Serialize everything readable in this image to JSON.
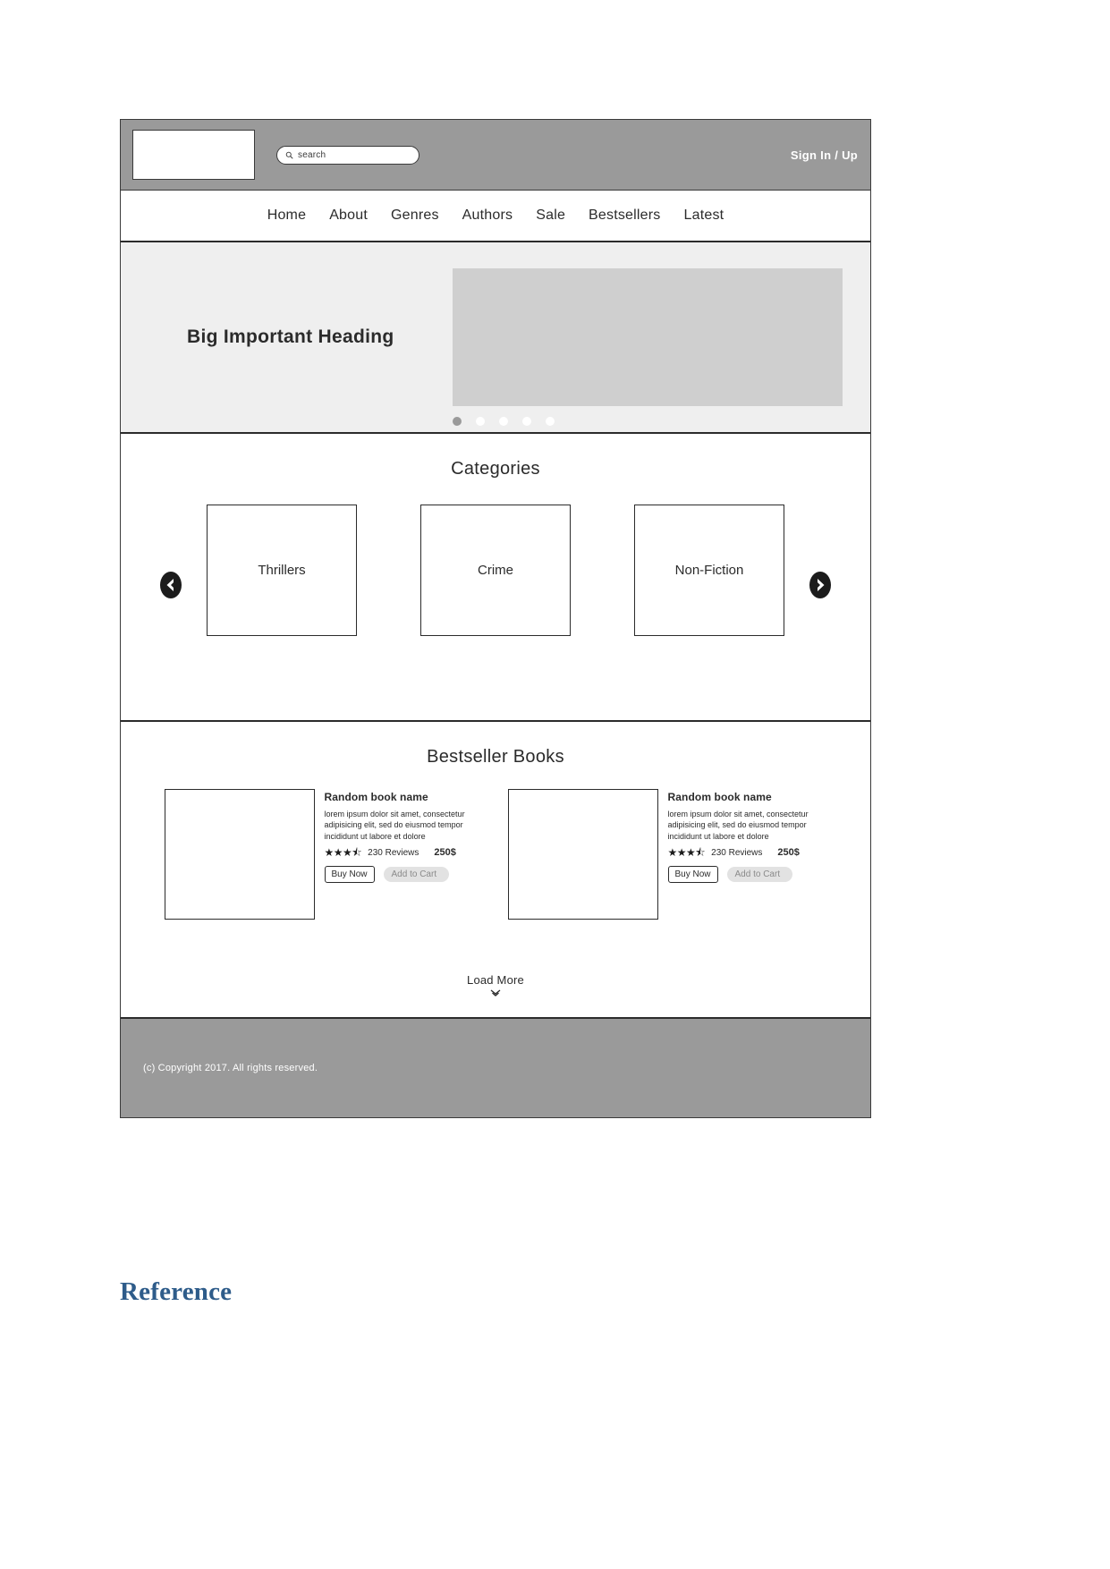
{
  "colors": {
    "bar_gray": "#9A9A9A",
    "hero_bg": "#EFEFEF",
    "placeholder_gray": "#CFCFCF",
    "outline": "#2B2B2B",
    "cart_btn_bg": "#E2E2E2",
    "reference_blue": "#2E5C8A"
  },
  "header": {
    "logo_alt": "logo-placeholder",
    "search": {
      "placeholder": "search",
      "value": "",
      "icon": "search-icon"
    },
    "signin_label": "Sign In / Up"
  },
  "nav": {
    "items": [
      {
        "label": "Home"
      },
      {
        "label": "About"
      },
      {
        "label": "Genres"
      },
      {
        "label": "Authors"
      },
      {
        "label": "Sale"
      },
      {
        "label": "Bestsellers"
      },
      {
        "label": "Latest"
      }
    ]
  },
  "hero": {
    "heading": "Big Important Heading",
    "image_alt": "hero-image-placeholder",
    "dots": [
      {
        "active": true
      },
      {
        "active": false
      },
      {
        "active": false
      },
      {
        "active": false
      },
      {
        "active": false
      }
    ]
  },
  "categories": {
    "title": "Categories",
    "prev_icon": "arrow-left-circle-icon",
    "next_icon": "arrow-right-circle-icon",
    "items": [
      {
        "label": "Thrillers"
      },
      {
        "label": "Crime"
      },
      {
        "label": "Non-Fiction"
      }
    ]
  },
  "bestsellers": {
    "title": "Bestseller Books",
    "books": [
      {
        "cover_alt": "book-cover-placeholder",
        "title": "Random book name",
        "description": "lorem ipsum dolor sit amet, consectetur adipisicing elit, sed do eiusmod tempor incididunt ut labore et dolore",
        "stars": "★★★⯪",
        "rating": 3.5,
        "reviews": "230 Reviews",
        "price": "250$",
        "buy_label": "Buy Now",
        "cart_label": "Add to Cart"
      },
      {
        "cover_alt": "book-cover-placeholder",
        "title": "Random book name",
        "description": "lorem ipsum dolor sit amet, consectetur adipisicing elit, sed do eiusmod tempor incididunt ut labore et dolore",
        "stars": "★★★⯪",
        "rating": 3.5,
        "reviews": "230 Reviews",
        "price": "250$",
        "buy_label": "Buy Now",
        "cart_label": "Add to Cart"
      }
    ],
    "load_more_label": "Load More",
    "load_more_icon": "chevron-double-down-icon"
  },
  "footer": {
    "copyright": "(c) Copyright 2017. All rights reserved."
  },
  "document": {
    "reference_heading": "Reference"
  }
}
